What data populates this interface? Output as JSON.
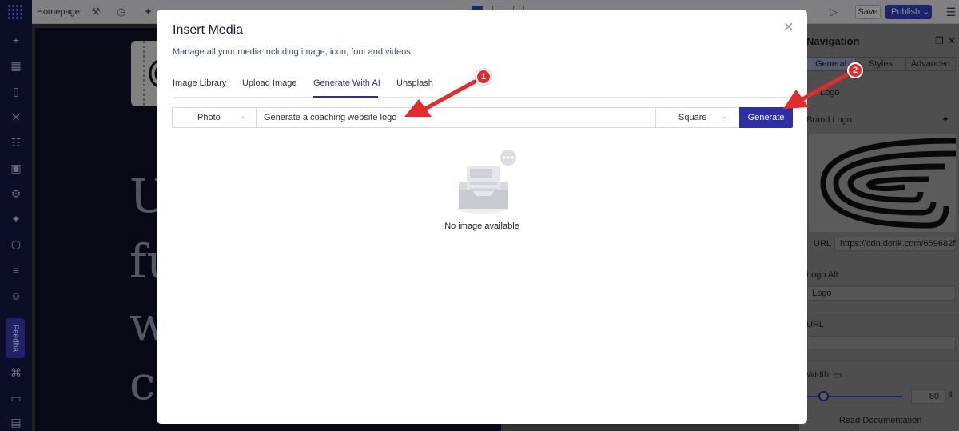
{
  "editor": {
    "tab_label": "Homepage",
    "save_label": "Save",
    "publish_label": "Publish",
    "feedback_label": "Feedba",
    "canvas_letters": [
      "U",
      "fu",
      "w",
      "c"
    ]
  },
  "panel": {
    "title": "Navigation",
    "tabs": [
      "General",
      "Styles",
      "Advanced"
    ],
    "logo_label": "Logo",
    "brand_logo_label": "Brand Logo",
    "url_label": "URL",
    "url_value": "https://cdn.dorik.com/659682f",
    "logo_alt_label": "Logo Alt",
    "logo_alt_value": "Logo",
    "link_url_label": "URL",
    "width_label": "Width",
    "width_value": "80",
    "read_docs": "Read Documentation"
  },
  "modal": {
    "title": "Insert Media",
    "subtitle": "Manage all your media including image, icon, font and videos",
    "tabs": [
      "Image Library",
      "Upload Image",
      "Generate With AI",
      "Unsplash"
    ],
    "active_tab": "Generate With AI",
    "type_value": "Photo",
    "prompt_value": "Generate a coaching website logo",
    "shape_value": "Square",
    "generate_label": "Generate",
    "empty_text": "No image available"
  },
  "annotations": {
    "marker_1": "1",
    "marker_2": "2",
    "color": "#e42a2a"
  },
  "colors": {
    "accent": "#2e2fa6",
    "sidebar": "#161a4a"
  }
}
